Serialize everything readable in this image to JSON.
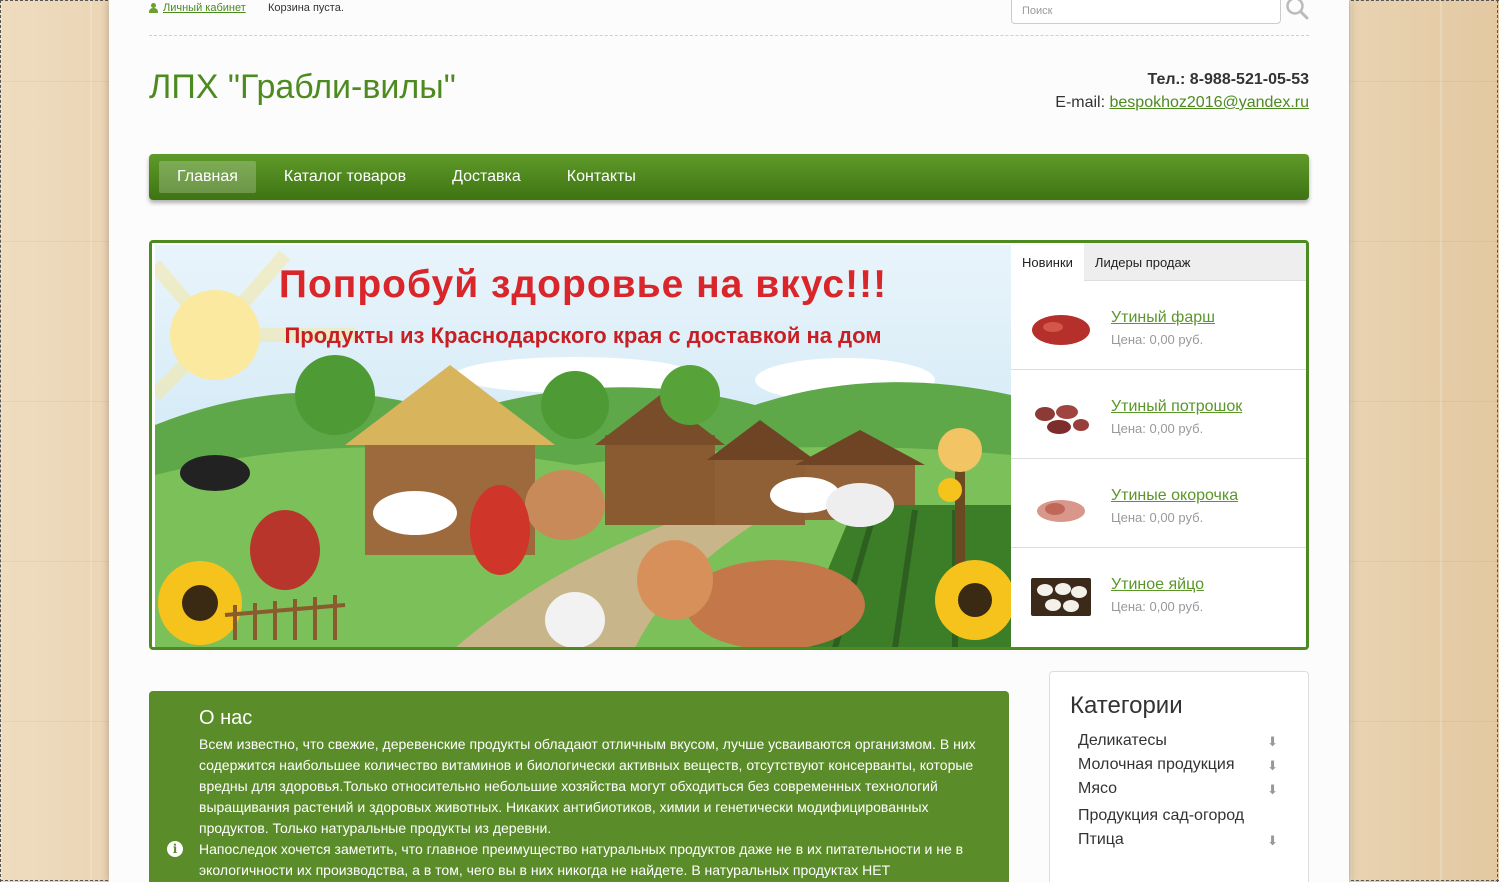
{
  "topbar": {
    "account_label": "Личный кабинет",
    "cart_status": "Корзина пуста.",
    "search_placeholder": "Поиск"
  },
  "header": {
    "site_title": "ЛПХ \"Грабли-вилы\"",
    "phone": "Тел.: 8-988-521-05-53",
    "email_label": "E-mail: ",
    "email": "bespokhoz2016@yandex.ru"
  },
  "nav": {
    "items": [
      {
        "label": "Главная",
        "active": true
      },
      {
        "label": "Каталог товаров",
        "active": false
      },
      {
        "label": "Доставка",
        "active": false
      },
      {
        "label": "Контакты",
        "active": false
      }
    ]
  },
  "banner": {
    "headline": "Попробуй здоровье на вкус!!!",
    "subline": "Продукты из Краснодарского края с доставкой на дом"
  },
  "product_tabs": {
    "tabs": [
      "Новинки",
      "Лидеры продаж"
    ],
    "active_tab": "Новинки",
    "products": [
      {
        "name": "Утиный фарш",
        "price": "Цена: 0,00 руб."
      },
      {
        "name": "Утиный потрошок",
        "price": "Цена: 0,00 руб."
      },
      {
        "name": "Утиные окорочка",
        "price": "Цена: 0,00 руб."
      },
      {
        "name": "Утиное яйцо",
        "price": "Цена: 0,00 руб."
      }
    ]
  },
  "about": {
    "title": "О нас",
    "paragraph1": "Всем известно, что свежие, деревенские продукты обладают отличным вкусом, лучше усваиваются организмом. В них содержится наибольшее количество витаминов и биологически активных веществ, отсутствуют консерванты, которые вредны для здоровья.Только относительно небольшие хозяйства могут обходиться без современных технологий выращивания растений и   здоровых животных. Никаких антибиотиков, химии и генетически модифицированных продуктов. Только натуральные продукты из деревни.",
    "paragraph2": "Напоследок хочется заметить, что главное преимущество натуральных продуктов даже не в их питательности и не в экологичности их производства, а в том, чего вы в них никогда не найдете. В натуральных продуктах НЕТ"
  },
  "categories": {
    "title": "Категории",
    "items": [
      {
        "label": "Деликатесы",
        "expandable": true
      },
      {
        "label": "Молочная продукция",
        "expandable": true
      },
      {
        "label": "Мясо",
        "expandable": true
      },
      {
        "label": "Продукция сад-огород",
        "expandable": false
      },
      {
        "label": "Птица",
        "expandable": true
      }
    ]
  },
  "colors": {
    "brand_green": "#4d8a1f",
    "about_bg": "#5b8c2a",
    "banner_red": "#d8262b"
  }
}
